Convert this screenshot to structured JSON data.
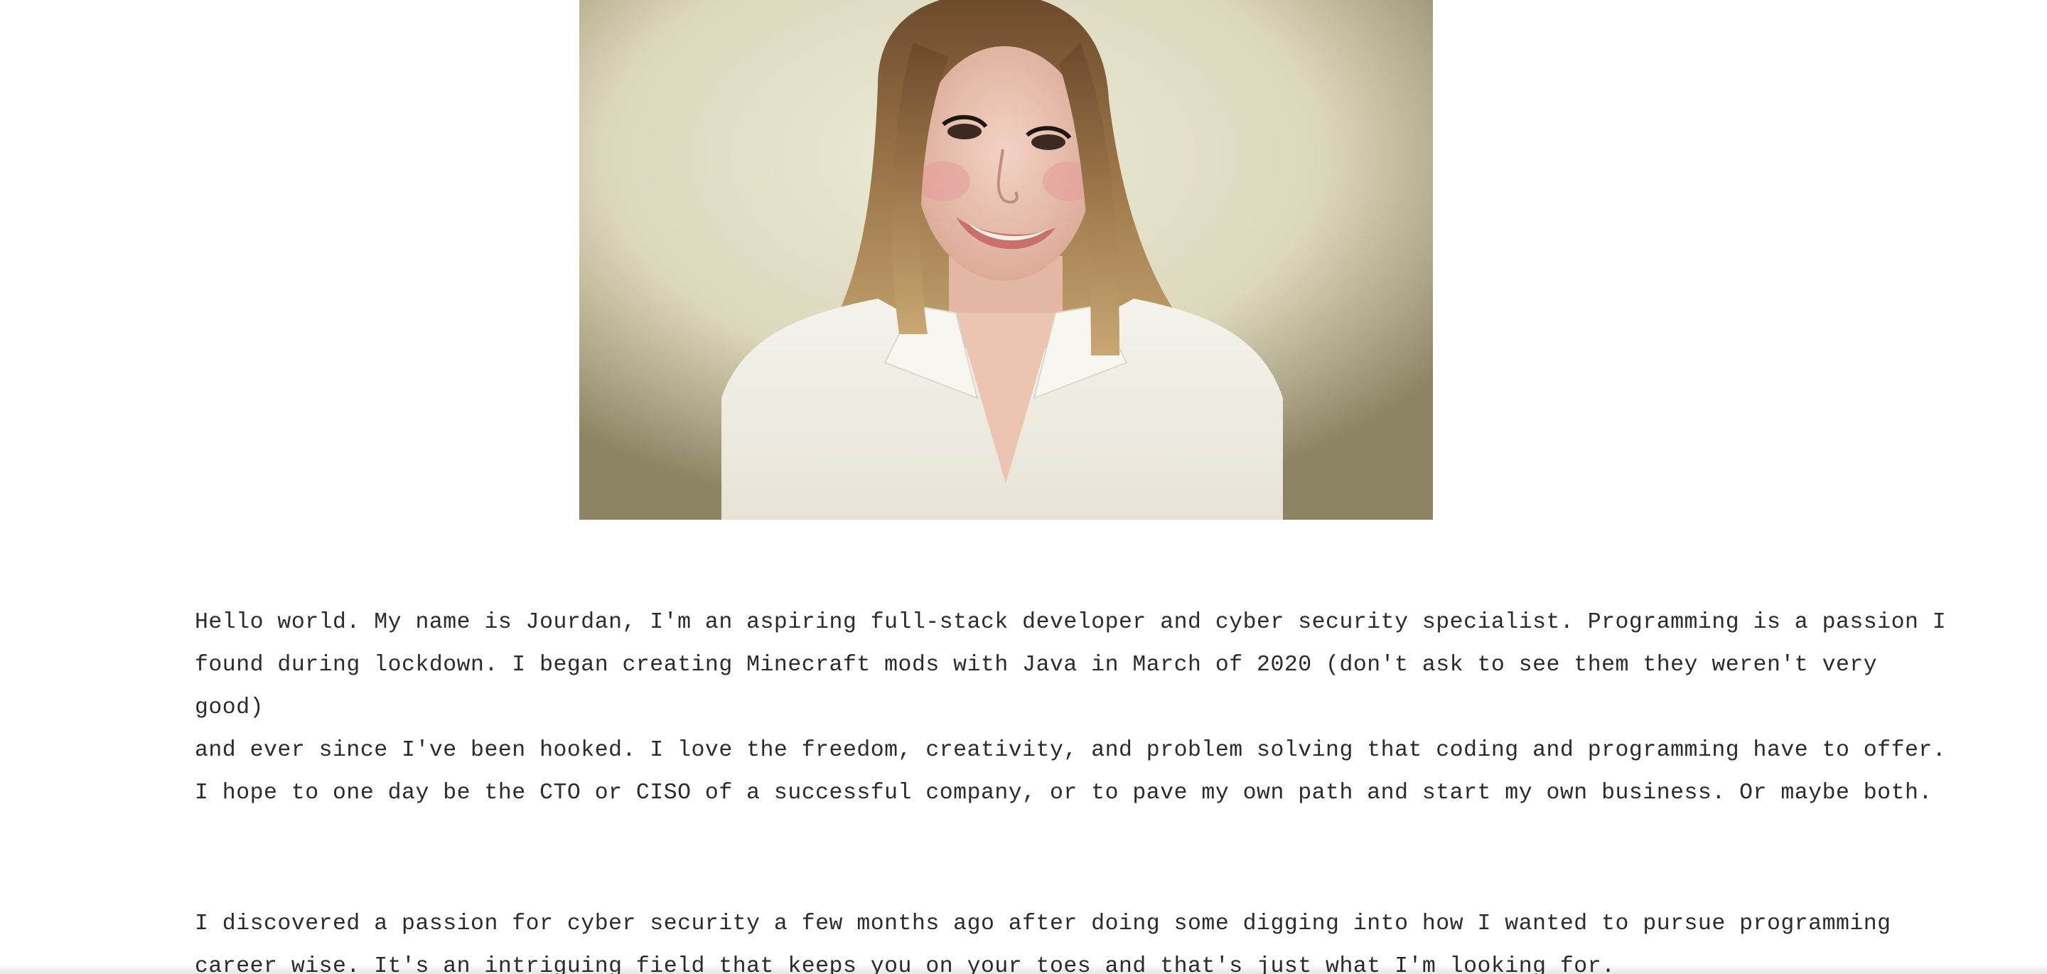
{
  "profile": {
    "photo_alt": "Portrait photo",
    "paragraphs": [
      "Hello world. My name is Jourdan, I'm an aspiring full-stack developer and cyber security specialist. Programming is a passion I\nfound during lockdown. I began creating Minecraft mods with Java in March of 2020 (don't ask to see them they weren't very good)\nand ever since I've been hooked. I love the freedom, creativity, and problem solving that coding and programming have to offer.\nI hope to one day be the CTO or CISO of a successful company, or to pave my own path and start my own business. Or maybe both.",
      "I discovered a passion for cyber security a few months ago after doing some digging into how I wanted to pursue programming\ncareer wise. It's an intriguing field that keeps you on your toes and that's just what I'm looking for."
    ]
  }
}
